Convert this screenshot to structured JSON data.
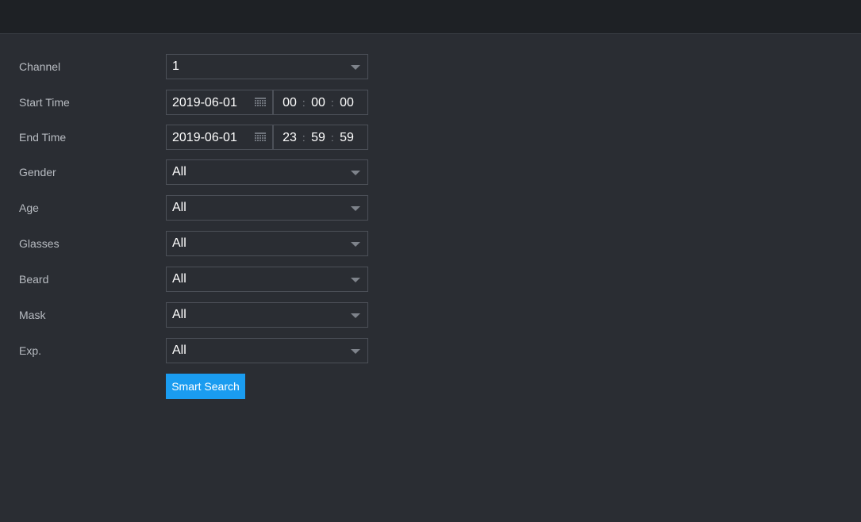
{
  "form": {
    "channel": {
      "label": "Channel",
      "value": "1"
    },
    "start_time": {
      "label": "Start Time",
      "date": "2019-06-01",
      "hour": "00",
      "minute": "00",
      "second": "00"
    },
    "end_time": {
      "label": "End Time",
      "date": "2019-06-01",
      "hour": "23",
      "minute": "59",
      "second": "59"
    },
    "gender": {
      "label": "Gender",
      "value": "All"
    },
    "age": {
      "label": "Age",
      "value": "All"
    },
    "glasses": {
      "label": "Glasses",
      "value": "All"
    },
    "beard": {
      "label": "Beard",
      "value": "All"
    },
    "mask": {
      "label": "Mask",
      "value": "All"
    },
    "expression": {
      "label": "Exp.",
      "value": "All"
    },
    "time_separator": ":",
    "search_button": "Smart Search"
  },
  "icons": {
    "calendar": "calendar-icon",
    "dropdown": "chevron-down-icon"
  },
  "colors": {
    "background": "#2a2d33",
    "topbar": "#1e2125",
    "accent": "#1a9cf0",
    "border": "#4c5058",
    "label": "#b8bcc2"
  }
}
